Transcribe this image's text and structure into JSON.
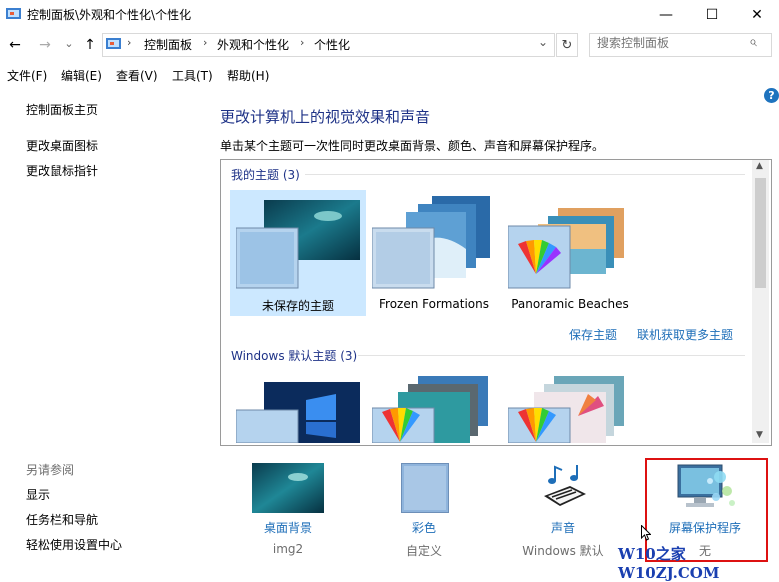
{
  "window": {
    "title": "控制面板\\外观和个性化\\个性化",
    "minimize": "—",
    "maximize": "☐",
    "close": "✕"
  },
  "nav": {
    "back": "←",
    "forward": "→",
    "recent": "⌄",
    "up": "↑",
    "breadcrumbs": [
      "控制面板",
      "外观和个性化",
      "个性化"
    ],
    "separator": "›",
    "dropdown": "⌄",
    "refresh": "↻",
    "search_placeholder": "搜索控制面板",
    "search_icon": "⌕"
  },
  "menu": [
    "文件(F)",
    "编辑(E)",
    "查看(V)",
    "工具(T)",
    "帮助(H)"
  ],
  "sidebar": {
    "links": [
      "控制面板主页",
      "更改桌面图标",
      "更改鼠标指针"
    ],
    "see_also_heading": "另请参阅",
    "see_also": [
      "显示",
      "任务栏和导航",
      "轻松使用设置中心"
    ]
  },
  "help_label": "?",
  "main": {
    "title": "更改计算机上的视觉效果和声音",
    "subtitle": "单击某个主题可一次性同时更改桌面背景、颜色、声音和屏幕保护程序。",
    "my_themes_heading": "我的主题 (3)",
    "my_themes": [
      {
        "name": "未保存的主题",
        "selected": true
      },
      {
        "name": "Frozen Formations",
        "selected": false
      },
      {
        "name": "Panoramic Beaches",
        "selected": false
      }
    ],
    "save_theme": "保存主题",
    "get_more": "联机获取更多主题",
    "default_heading": "Windows 默认主题 (3)"
  },
  "bottom": [
    {
      "label": "桌面背景",
      "sub": "img2",
      "icon": "desktop-background-icon"
    },
    {
      "label": "彩色",
      "sub": "自定义",
      "icon": "color-icon"
    },
    {
      "label": "声音",
      "sub": "Windows 默认",
      "icon": "sound-icon"
    },
    {
      "label": "屏幕保护程序",
      "sub": "无",
      "icon": "screensaver-icon"
    }
  ],
  "watermark": "W10之家 W10ZJ.COM",
  "colors": {
    "link": "#1e6eb8",
    "title": "#1e3287",
    "selected": "#cce8ff",
    "highlight": "#d11111"
  }
}
